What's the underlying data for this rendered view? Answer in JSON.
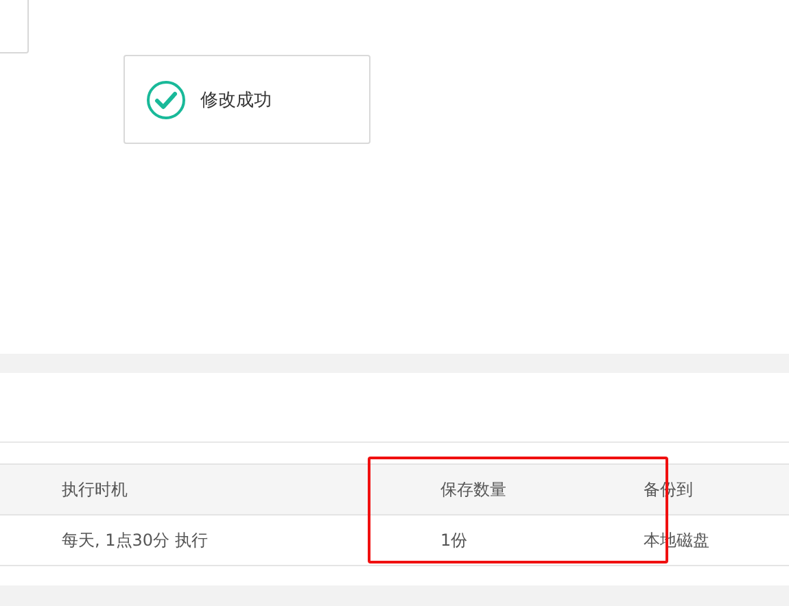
{
  "toast": {
    "message": "修改成功",
    "kind": "success"
  },
  "table": {
    "columns": [
      "执行时机",
      "保存数量",
      "备份到"
    ],
    "rows": [
      [
        "每天, 1点30分 执行",
        "1份",
        "本地磁盘"
      ]
    ]
  }
}
